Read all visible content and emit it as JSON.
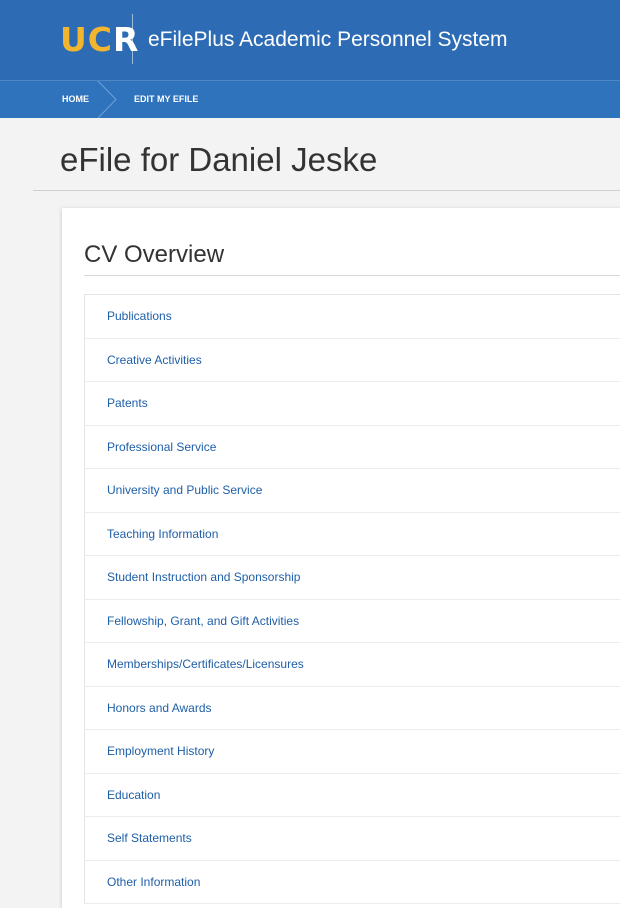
{
  "header": {
    "logo_main": "UC",
    "logo_accent": "R",
    "system_title": "eFilePlus Academic Personnel System",
    "colors": {
      "header_bg": "#2d6cb4",
      "logo": "#f1b52e",
      "link": "#1e5fa8"
    }
  },
  "breadcrumb": {
    "home": "HOME",
    "current": "EDIT MY EFILE"
  },
  "page": {
    "title": "eFile for Daniel Jeske"
  },
  "cv_overview": {
    "title": "CV Overview",
    "items": [
      {
        "label": "Publications"
      },
      {
        "label": "Creative Activities"
      },
      {
        "label": "Patents"
      },
      {
        "label": "Professional Service"
      },
      {
        "label": "University and Public Service"
      },
      {
        "label": "Teaching Information"
      },
      {
        "label": "Student Instruction and Sponsorship"
      },
      {
        "label": "Fellowship, Grant, and Gift Activities"
      },
      {
        "label": "Memberships/Certificates/Licensures"
      },
      {
        "label": "Honors and Awards"
      },
      {
        "label": "Employment History"
      },
      {
        "label": "Education"
      },
      {
        "label": "Self Statements"
      },
      {
        "label": "Other Information"
      }
    ]
  }
}
